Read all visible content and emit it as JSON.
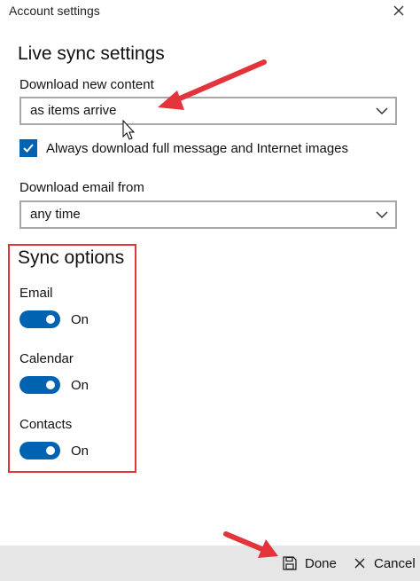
{
  "window": {
    "title": "Account settings"
  },
  "live_sync": {
    "heading": "Live sync settings",
    "download_new_content": {
      "label": "Download new content",
      "value": "as items arrive"
    },
    "always_download": {
      "label": "Always download full message and Internet images",
      "checked": true
    },
    "download_email_from": {
      "label": "Download email from",
      "value": "any time"
    }
  },
  "sync_options": {
    "heading": "Sync options",
    "items": [
      {
        "label": "Email",
        "state": "On"
      },
      {
        "label": "Calendar",
        "state": "On"
      },
      {
        "label": "Contacts",
        "state": "On"
      }
    ]
  },
  "footer": {
    "done_label": "Done",
    "cancel_label": "Cancel"
  },
  "colors": {
    "accent": "#0063b1",
    "annotation": "#e2343a",
    "footer_bg": "#e6e6e6"
  },
  "icons": [
    "close-icon",
    "chevron-down-icon",
    "checkmark-icon",
    "save-icon",
    "cancel-icon"
  ]
}
